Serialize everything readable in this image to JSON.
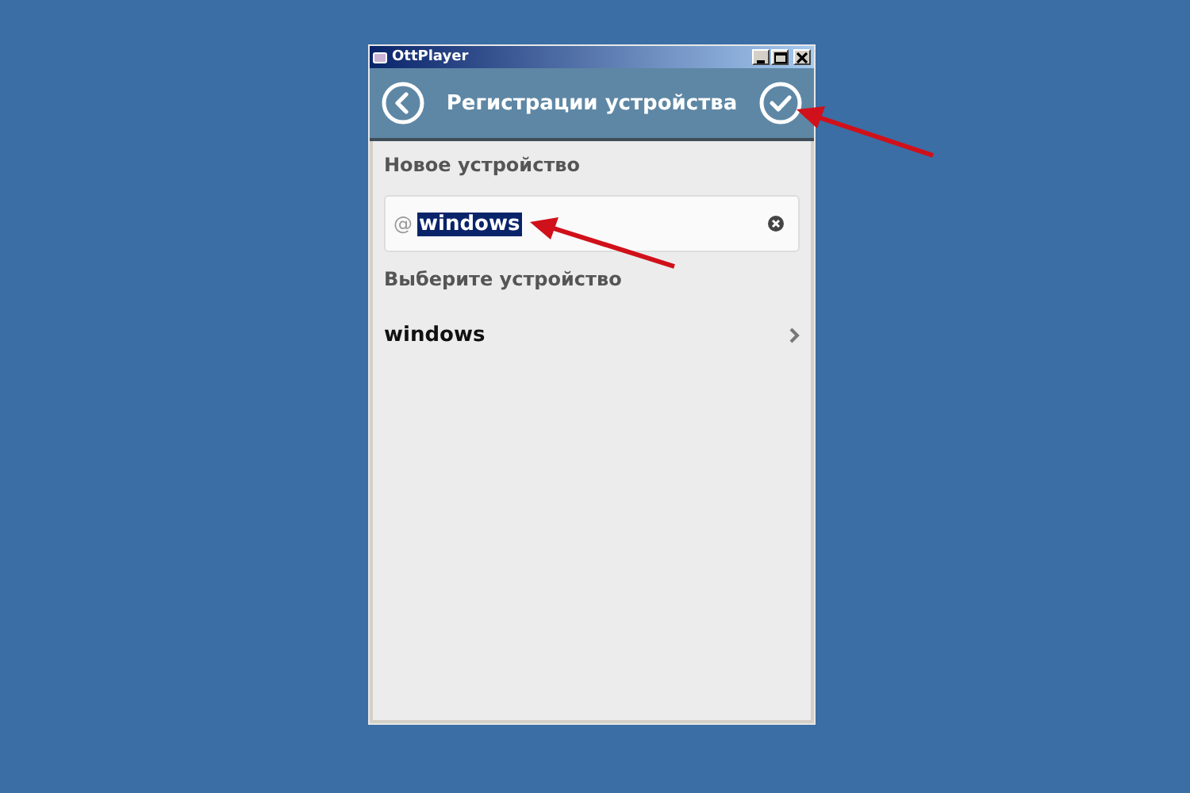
{
  "window": {
    "title": "OttPlayer"
  },
  "header": {
    "title": "Регистрации устройства"
  },
  "new_device": {
    "label": "Новое устройство",
    "field": {
      "prefix": "@",
      "value": "windows",
      "value_selected": true
    }
  },
  "choose": {
    "label": "Выберите устройство",
    "items": [
      {
        "name": "windows"
      }
    ]
  }
}
